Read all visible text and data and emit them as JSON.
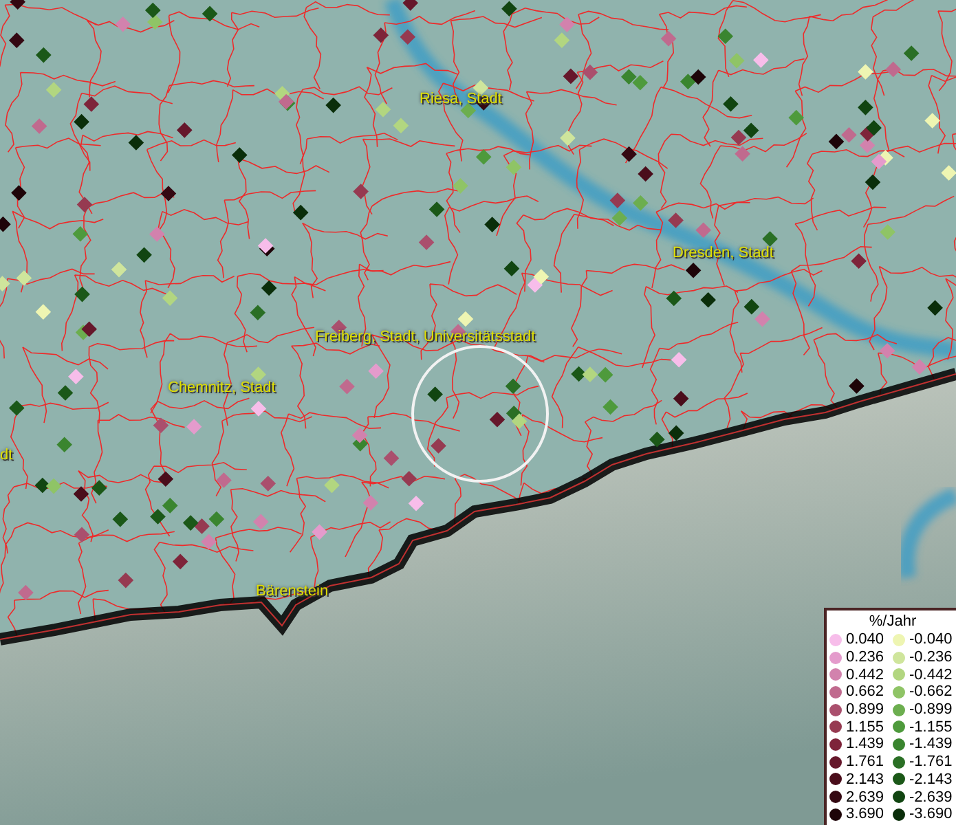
{
  "places": [
    {
      "name": "Riesa, Stadt"
    },
    {
      "name": "Dresden, Stadt"
    },
    {
      "name": "Freiberg, Stadt, Universitätsstadt"
    },
    {
      "name": "Chemnitz, Stadt"
    },
    {
      "name": "dt"
    },
    {
      "name": "Bärenstein"
    }
  ],
  "legend": {
    "title": "%/Jahr",
    "items": [
      {
        "value": "0.040",
        "color": "#f7bdea"
      },
      {
        "value": "-0.040",
        "color": "#eef5b2"
      },
      {
        "value": "0.236",
        "color": "#e49bcc"
      },
      {
        "value": "-0.236",
        "color": "#cfe59c"
      },
      {
        "value": "0.442",
        "color": "#d282ad"
      },
      {
        "value": "-0.442",
        "color": "#b2d680"
      },
      {
        "value": "0.662",
        "color": "#c06a8e"
      },
      {
        "value": "-0.662",
        "color": "#8fc466"
      },
      {
        "value": "0.899",
        "color": "#aa4f6d"
      },
      {
        "value": "-0.899",
        "color": "#6cae4f"
      },
      {
        "value": "1.155",
        "color": "#963a51"
      },
      {
        "value": "-1.155",
        "color": "#4e9a3c"
      },
      {
        "value": "1.439",
        "color": "#7e243a"
      },
      {
        "value": "-1.439",
        "color": "#3a852f"
      },
      {
        "value": "1.761",
        "color": "#66172b"
      },
      {
        "value": "-1.761",
        "color": "#2a6f25"
      },
      {
        "value": "2.143",
        "color": "#4a0d1b"
      },
      {
        "value": "-2.143",
        "color": "#1b5818"
      },
      {
        "value": "2.639",
        "color": "#340812"
      },
      {
        "value": "-2.639",
        "color": "#114511"
      },
      {
        "value": "3.690",
        "color": "#1e0408"
      },
      {
        "value": "-3.690",
        "color": "#0a2e0a"
      }
    ]
  }
}
